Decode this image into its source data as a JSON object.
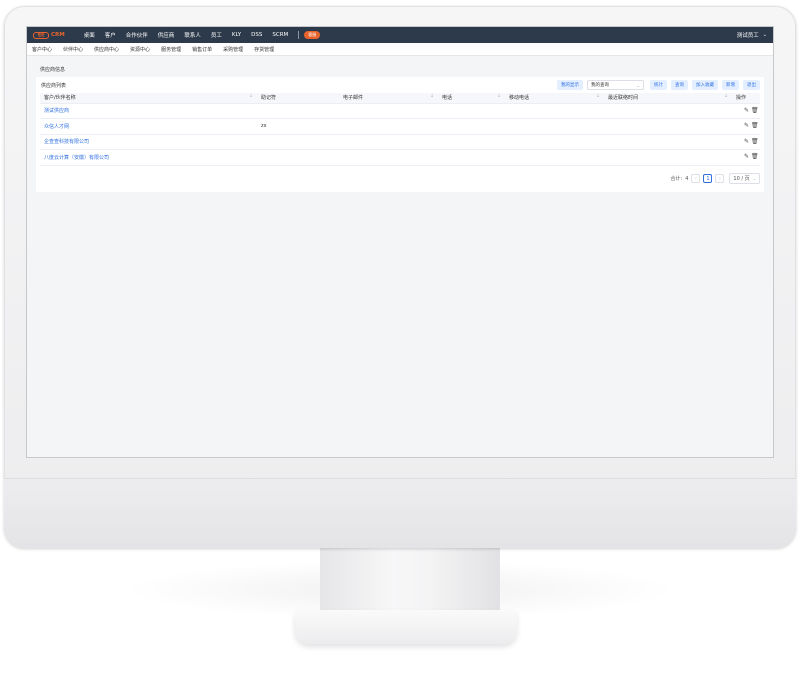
{
  "topnav": {
    "logo_mark": "悟空",
    "logo_text": "CRM",
    "items": [
      "桌面",
      "客户",
      "合作伙伴",
      "供应商",
      "联系人",
      "员工",
      "KLY",
      "DSS",
      "SCRM"
    ],
    "badge": "客服",
    "user": "测试员工"
  },
  "subnav": {
    "items": [
      "客户中心",
      "伙伴中心",
      "供应商中心",
      "资源中心",
      "服务管理",
      "销售订单",
      "采购管理",
      "存货管理"
    ]
  },
  "page": {
    "section_title": "供应商信息"
  },
  "panel": {
    "title": "供应商列表",
    "buttons": {
      "my_display": "我的显示",
      "stats": "统计",
      "query": "查询",
      "favorite": "加入收藏",
      "add": "新增",
      "exit": "退出"
    },
    "select_value": "我的查询"
  },
  "table": {
    "columns": [
      "客户/伙伴名称",
      "助记符",
      "电子邮件",
      "电话",
      "移动电话",
      "最近联络时间",
      "操作"
    ],
    "rows": [
      {
        "name": "测试供应商",
        "code": "",
        "email": "",
        "phone": "",
        "mobile": "",
        "last_contact": ""
      },
      {
        "name": "众信人才网",
        "code": "zx",
        "email": "",
        "phone": "",
        "mobile": "",
        "last_contact": ""
      },
      {
        "name": "企查查科技有限公司",
        "code": "",
        "email": "",
        "phone": "",
        "mobile": "",
        "last_contact": ""
      },
      {
        "name": "八度云计算（安徽）有限公司",
        "code": "",
        "email": "",
        "phone": "",
        "mobile": "",
        "last_contact": ""
      }
    ]
  },
  "pager": {
    "total_label": "合计:",
    "total": "4",
    "current_page": "1",
    "page_size": "10 / 页"
  },
  "colors": {
    "nav_bg": "#2d3a4b",
    "accent": "#e8632c",
    "link": "#2f6fe0",
    "button_bg": "#e3efff"
  }
}
